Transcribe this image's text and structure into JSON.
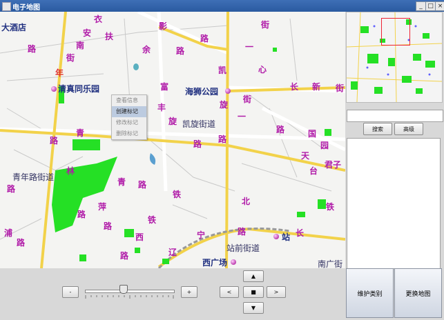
{
  "window": {
    "title": "电子地图",
    "minimize": "_",
    "maximize": "□",
    "close": "×"
  },
  "map": {
    "labels_road": [
      "衣",
      "安",
      "扶",
      "南",
      "街",
      "余",
      "影",
      "路",
      "街",
      "一",
      "心",
      "凯",
      "长",
      "新",
      "街",
      "旋",
      "富",
      "丰",
      "街",
      "路",
      "一",
      "青",
      "路",
      "旋",
      "路",
      "天",
      "君子",
      "国",
      "台",
      "路",
      "林",
      "青",
      "路",
      "路",
      "北",
      "路",
      "萍",
      "铁",
      "铁",
      "路",
      "路",
      "西",
      "宁",
      "路",
      "长",
      "辽",
      "浦",
      "路",
      "路",
      "园",
      "铁",
      "路"
    ],
    "labels_red": [
      "年"
    ],
    "labels_poi": [
      "大酒店",
      "清真同乐园",
      "海狮公园",
      "西广场",
      "站"
    ],
    "labels_place": [
      "凯旋街道",
      "青年路街道",
      "站前街道",
      "南广街"
    ]
  },
  "context_menu": {
    "items": [
      "查看信息",
      "创建标记",
      "修改标记",
      "删除标记"
    ],
    "active_index": 1
  },
  "side": {
    "search_value": "",
    "search_button": "搜索",
    "advanced_button": "高级"
  },
  "zoom": {
    "minus": "-",
    "plus": "+",
    "level": 0.42
  },
  "nav": {
    "up": "▲",
    "left": "<",
    "center": "■",
    "right": ">",
    "down": "▼"
  },
  "actions": {
    "maintain_category": "维护类别",
    "change_map": "更换地图"
  },
  "colors": {
    "road_yellow": "#f2d24a",
    "park_green": "#25e025",
    "label_purple": "#b01aa8"
  }
}
